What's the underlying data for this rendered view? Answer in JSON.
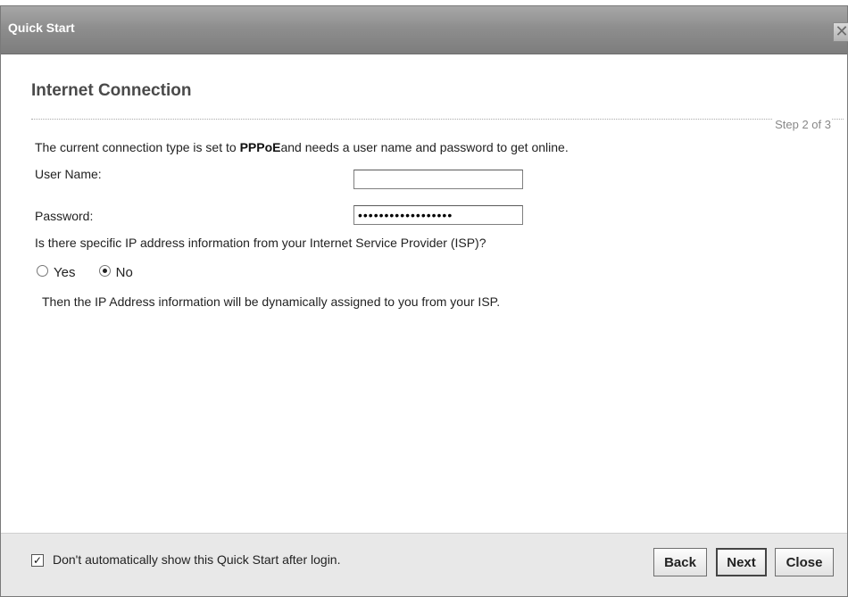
{
  "dialog": {
    "title": "Quick Start",
    "close_glyph": "✕"
  },
  "page": {
    "heading": "Internet Connection",
    "step": "Step 2 of 3",
    "intro_prefix": "The current connection type is set to ",
    "intro_type": "PPPoE",
    "intro_suffix": "and needs a user name and password to get online."
  },
  "form": {
    "username_label": "User Name:",
    "username_value": "",
    "password_label": "Password:",
    "password_value": "••••••••••••••••••",
    "question": "Is there specific IP address information from your Internet Service Provider (ISP)?",
    "options": [
      {
        "label": "Yes",
        "checked": false
      },
      {
        "label": "No",
        "checked": true
      }
    ],
    "dynamic_note": "Then the IP Address information will be dynamically assigned to you from your ISP."
  },
  "footer": {
    "checkbox_checked": true,
    "checkbox_label": "Don't automatically show this Quick Start after login.",
    "back_label": "Back",
    "next_label": "Next",
    "close_label": "Close"
  }
}
